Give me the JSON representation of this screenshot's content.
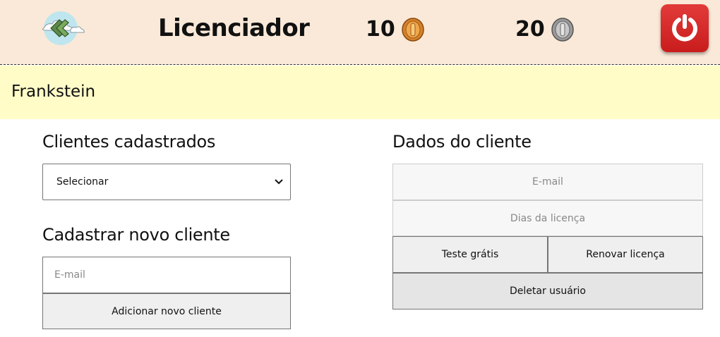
{
  "header": {
    "title": "Licenciador",
    "gold_count": "10",
    "silver_count": "20"
  },
  "banner": {
    "user_name": "Frankstein"
  },
  "clients": {
    "heading": "Clientes cadastrados",
    "select_value": "Selecionar"
  },
  "new_client": {
    "heading": "Cadastrar novo cliente",
    "email_placeholder": "E-mail",
    "add_button": "Adicionar novo cliente"
  },
  "client_data": {
    "heading": "Dados do cliente",
    "email_placeholder": "E-mail",
    "days_placeholder": "Dias da licença",
    "trial_button": "Teste grátis",
    "renew_button": "Renovar licença",
    "delete_button": "Deletar usuário"
  },
  "colors": {
    "header_bg": "#fae9d8",
    "banner_bg": "#fffcc8",
    "power_button": "#d62828"
  },
  "icons": [
    "back-arrow-cloud-icon",
    "gold-coin-icon",
    "silver-coin-icon",
    "power-icon",
    "chevron-down-icon"
  ]
}
